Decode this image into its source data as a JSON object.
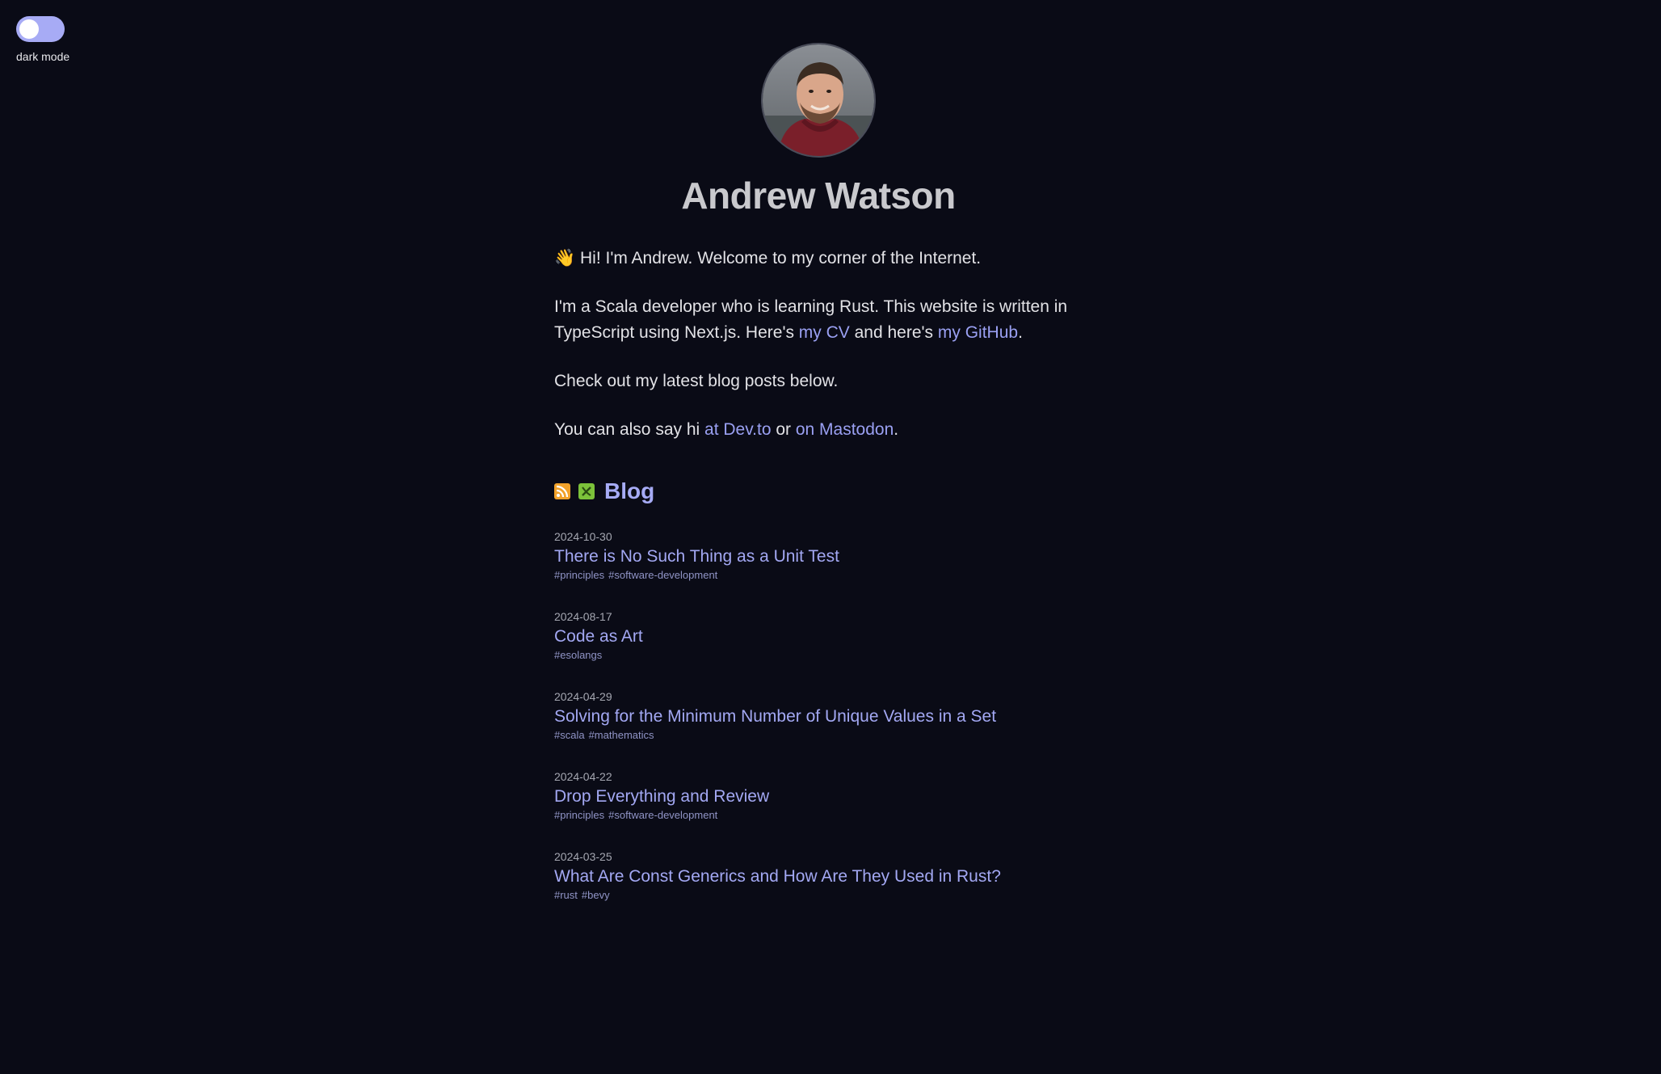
{
  "theme_toggle": {
    "label": "dark mode"
  },
  "profile": {
    "name": "Andrew Watson",
    "avatar_icon": "profile-photo"
  },
  "intro": {
    "greeting_emoji": "👋",
    "greeting": " Hi! I'm Andrew. Welcome to my corner of the Internet.",
    "about_prefix": "I'm a Scala developer who is learning Rust. This website is written in TypeScript using Next.js. Here's ",
    "cv_link": "my CV",
    "about_middle": " and here's ",
    "github_link": "my GitHub",
    "about_suffix": ".",
    "blog_line": "Check out my latest blog posts below.",
    "say_hi_prefix": "You can also say hi ",
    "devto_link": "at Dev.to",
    "say_hi_middle": " or ",
    "mastodon_link": "on Mastodon",
    "say_hi_suffix": "."
  },
  "blog": {
    "title": "Blog",
    "rss_icon": "rss-icon",
    "feed_icon": "atom-feed-icon",
    "posts": [
      {
        "date": "2024-10-30",
        "title": "There is No Such Thing as a Unit Test",
        "tags": [
          "#principles",
          "#software-development"
        ]
      },
      {
        "date": "2024-08-17",
        "title": "Code as Art",
        "tags": [
          "#esolangs"
        ]
      },
      {
        "date": "2024-04-29",
        "title": "Solving for the Minimum Number of Unique Values in a Set",
        "tags": [
          "#scala",
          "#mathematics"
        ]
      },
      {
        "date": "2024-04-22",
        "title": "Drop Everything and Review",
        "tags": [
          "#principles",
          "#software-development"
        ]
      },
      {
        "date": "2024-03-25",
        "title": "What Are Const Generics and How Are They Used in Rust?",
        "tags": [
          "#rust",
          "#bevy"
        ]
      }
    ]
  },
  "colors": {
    "background": "#0a0b16",
    "text": "#e2e2e6",
    "link": "#9aa0f2",
    "toggle_track": "#a7abf5"
  }
}
